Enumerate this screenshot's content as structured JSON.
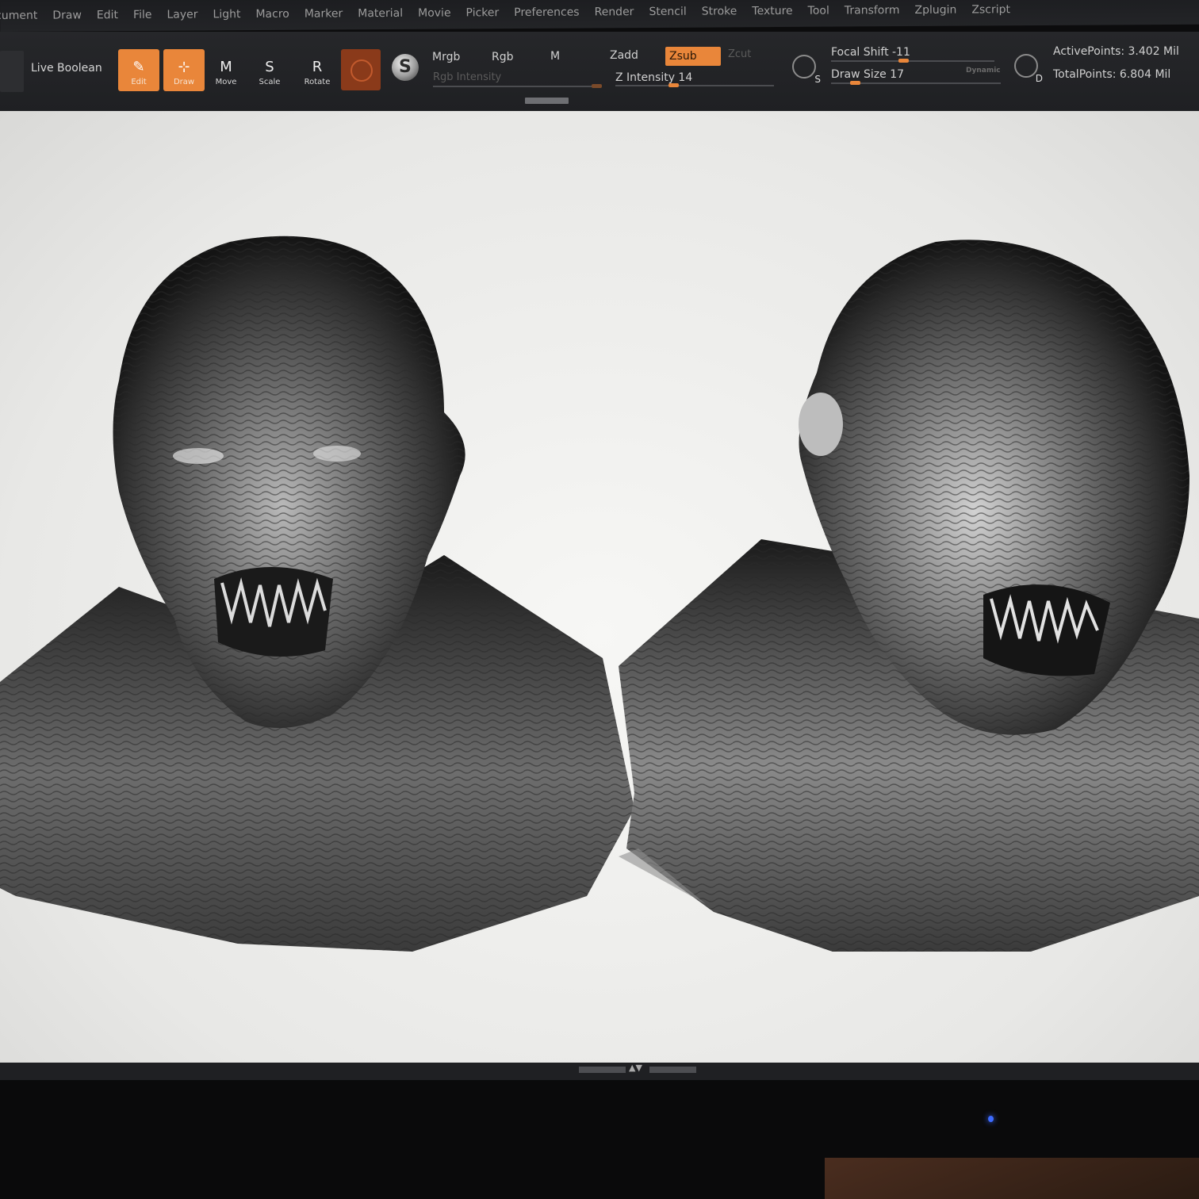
{
  "menu": [
    "cument",
    "Draw",
    "Edit",
    "File",
    "Layer",
    "Light",
    "Macro",
    "Marker",
    "Material",
    "Movie",
    "Picker",
    "Preferences",
    "Render",
    "Stencil",
    "Stroke",
    "Texture",
    "Tool",
    "Transform",
    "Zplugin",
    "Zscript"
  ],
  "shelf": {
    "live_boolean": "Live Boolean",
    "tools": [
      {
        "label": "Edit",
        "glyph": "✎",
        "active": true
      },
      {
        "label": "Draw",
        "glyph": "⊹",
        "active": true
      },
      {
        "label": "Move",
        "glyph": "M",
        "active": false
      },
      {
        "label": "Scale",
        "glyph": "S",
        "active": false
      },
      {
        "label": "Rotate",
        "glyph": "R",
        "active": false
      }
    ],
    "mrgb": "Mrgb",
    "rgb": "Rgb",
    "m": "M",
    "rgb_intensity": "Rgb Intensity",
    "zadd": "Zadd",
    "zsub": "Zsub",
    "zcut": "Zcut",
    "z_intensity": "Z Intensity 14",
    "focal_shift": "Focal Shift -11",
    "draw_size": "Draw Size 17",
    "dynamic": "Dynamic",
    "active_points": "ActivePoints: 3.402 Mil",
    "total_points": "TotalPoints: 6.804 Mil",
    "icon_s": "S",
    "icon_d": "D"
  },
  "colors": {
    "accent": "#e9863a",
    "canvas_bg": "#efefed",
    "ui_bg": "#222326"
  }
}
